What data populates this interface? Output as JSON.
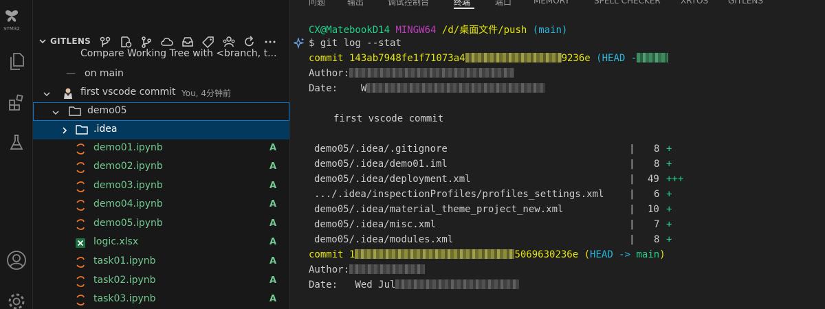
{
  "activity_bar": {
    "stm_label": "STM32",
    "icons": [
      "stm32-icon",
      "explorer-icon",
      "extensions-icon",
      "testing-icon",
      "account-icon",
      "settings-icon"
    ]
  },
  "sidebar": {
    "title": "GITLENS",
    "rows": [
      {
        "label": "Compare Working Tree with <branch, t..."
      },
      {
        "dash": "—",
        "label": "on main"
      },
      {
        "label": "first vscode commit",
        "meta": "You, 4分钟前"
      },
      {
        "label": "demo05"
      },
      {
        "label": ".idea"
      },
      {
        "label": "demo01.ipynb",
        "status": "A"
      },
      {
        "label": "demo02.ipynb",
        "status": "A"
      },
      {
        "label": "demo03.ipynb",
        "status": "A"
      },
      {
        "label": "demo04.ipynb",
        "status": "A"
      },
      {
        "label": "demo05.ipynb",
        "status": "A"
      },
      {
        "label": "logic.xlsx",
        "status": "A"
      },
      {
        "label": "task01.ipynb",
        "status": "A"
      },
      {
        "label": "task02.ipynb",
        "status": "A"
      },
      {
        "label": "task03.ipynb",
        "status": "A"
      }
    ]
  },
  "panel": {
    "tabs": [
      "问题",
      "输出",
      "调试控制台",
      "终端",
      "端口",
      "MEMORY",
      "SPELL CHECKER",
      "XRTOS",
      "GITLENS"
    ],
    "active_tab": "终端"
  },
  "terminal": {
    "prompt_user": "CX@MatebookD14",
    "prompt_env": "MINGW64",
    "prompt_path": "/d/桌面文件/push",
    "prompt_branch": "(main)",
    "command": "$ git log --stat",
    "commit1_prefix": "commit 143ab7948fe1f71073a4",
    "commit1_suffix": "9236e",
    "commit1_head": "(HEAD -",
    "author_label": "Author:",
    "date_label": "Date:",
    "date1_partial": "W",
    "message": "first vscode commit",
    "stat_files": [
      {
        "file": "demo05/.idea/.gitignore",
        "count": "8",
        "plus": "+"
      },
      {
        "file": "demo05/.idea/demo01.iml",
        "count": "8",
        "plus": "+"
      },
      {
        "file": "demo05/.idea/deployment.xml",
        "count": "49",
        "plus": "+++"
      },
      {
        "file": ".../.idea/inspectionProfiles/profiles_settings.xml",
        "count": "6",
        "plus": "+"
      },
      {
        "file": "demo05/.idea/material_theme_project_new.xml",
        "count": "10",
        "plus": "+"
      },
      {
        "file": "demo05/.idea/misc.xml",
        "count": "7",
        "plus": "+"
      },
      {
        "file": "demo05/.idea/modules.xml",
        "count": "8",
        "plus": "+"
      }
    ],
    "commit2_prefix": "commit 1",
    "commit2_suffix": "5069630236e",
    "commit2_head_open": "(",
    "commit2_head": "HEAD -> ",
    "commit2_branch": "main",
    "commit2_head_close": ")",
    "date2_partial": "Wed Jul"
  },
  "colors": {
    "activity_bg": "#181818",
    "panel_bg": "#1f1f1f",
    "selection": "#04395e",
    "focus_border": "#0078d4",
    "added_green": "#73c991",
    "term_green": "#23d18b",
    "term_yellow": "#e5e510",
    "term_cyan": "#29b8db",
    "term_purple": "#bc3fbc"
  }
}
